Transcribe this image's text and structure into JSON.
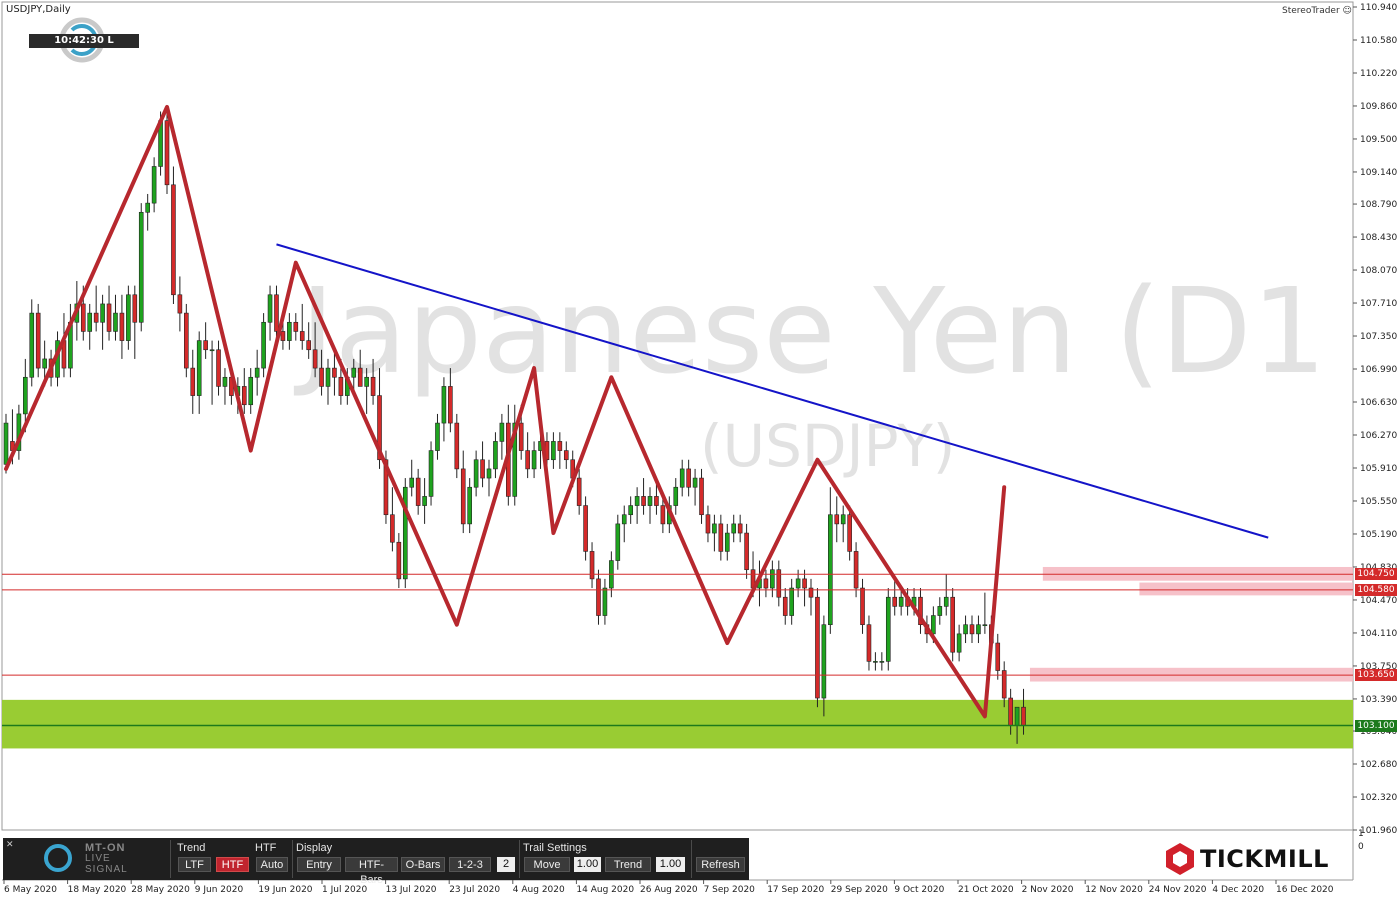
{
  "header": {
    "symbol_label": "USDJPY,Daily",
    "clock": "10:42:30 L",
    "stereo_trader": "StereoTrader"
  },
  "watermark": {
    "title": "Japanese Yen (D1",
    "subtitle": "(USDJPY)"
  },
  "price_axis": {
    "ticks": [
      "110.940",
      "110.580",
      "110.220",
      "109.860",
      "109.500",
      "109.140",
      "108.790",
      "108.430",
      "108.070",
      "107.710",
      "107.350",
      "106.990",
      "106.630",
      "106.270",
      "105.910",
      "105.550",
      "105.190",
      "104.830",
      "104.470",
      "104.110",
      "103.750",
      "103.390",
      "103.040",
      "102.680",
      "102.320",
      "101.960"
    ],
    "ylim": [
      101.96,
      110.94
    ],
    "levels": [
      {
        "value": 104.75,
        "label": "104.750",
        "color": "#d42a2a"
      },
      {
        "value": 104.58,
        "label": "104.580",
        "color": "#d42a2a"
      },
      {
        "value": 103.65,
        "label": "103.650",
        "color": "#d42a2a"
      },
      {
        "value": 103.1,
        "label": "103.100",
        "color": "#1c7a1c"
      }
    ]
  },
  "time_axis": {
    "ticks": [
      "6 May 2020",
      "18 May 2020",
      "28 May 2020",
      "9 Jun 2020",
      "19 Jun 2020",
      "1 Jul 2020",
      "13 Jul 2020",
      "23 Jul 2020",
      "4 Aug 2020",
      "14 Aug 2020",
      "26 Aug 2020",
      "7 Sep 2020",
      "17 Sep 2020",
      "29 Sep 2020",
      "9 Oct 2020",
      "21 Oct 2020",
      "2 Nov 2020",
      "12 Nov 2020",
      "24 Nov 2020",
      "4 Dec 2020",
      "16 Dec 2020"
    ]
  },
  "sub_axis": {
    "ticks": [
      "1",
      "0"
    ]
  },
  "chart_data": {
    "type": "candlestick",
    "series": [
      {
        "candles": [
          [
            105.95,
            106.5,
            105.85,
            106.4
          ],
          [
            106.2,
            106.55,
            105.95,
            106.1
          ],
          [
            106.1,
            106.6,
            106.0,
            106.5
          ],
          [
            106.5,
            107.1,
            106.3,
            106.9
          ],
          [
            106.9,
            107.75,
            106.8,
            107.6
          ],
          [
            107.6,
            107.7,
            106.9,
            107.0
          ],
          [
            107.0,
            107.3,
            106.8,
            107.1
          ],
          [
            107.1,
            107.2,
            106.8,
            106.9
          ],
          [
            106.9,
            107.4,
            106.8,
            107.3
          ],
          [
            107.3,
            107.6,
            106.9,
            107.0
          ],
          [
            107.0,
            107.7,
            106.9,
            107.5
          ],
          [
            107.5,
            107.95,
            107.3,
            107.7
          ],
          [
            107.7,
            107.9,
            107.3,
            107.4
          ],
          [
            107.4,
            107.7,
            107.2,
            107.6
          ],
          [
            107.6,
            107.9,
            107.4,
            107.5
          ],
          [
            107.5,
            107.8,
            107.2,
            107.7
          ],
          [
            107.7,
            107.9,
            107.3,
            107.4
          ],
          [
            107.4,
            107.8,
            107.3,
            107.6
          ],
          [
            107.6,
            107.8,
            107.1,
            107.3
          ],
          [
            107.3,
            107.9,
            107.2,
            107.8
          ],
          [
            107.8,
            107.9,
            107.1,
            107.5
          ],
          [
            107.5,
            108.8,
            107.4,
            108.7
          ],
          [
            108.7,
            108.9,
            108.5,
            108.8
          ],
          [
            108.8,
            109.3,
            108.7,
            109.2
          ],
          [
            109.2,
            109.8,
            109.1,
            109.7
          ],
          [
            109.7,
            109.85,
            108.9,
            109.0
          ],
          [
            109.0,
            109.2,
            107.7,
            107.8
          ],
          [
            107.8,
            108.0,
            107.4,
            107.6
          ],
          [
            107.6,
            107.7,
            106.9,
            107.0
          ],
          [
            107.0,
            107.2,
            106.5,
            106.7
          ],
          [
            106.7,
            107.4,
            106.5,
            107.3
          ],
          [
            107.3,
            107.5,
            107.1,
            107.2
          ],
          [
            107.2,
            107.3,
            106.6,
            107.2
          ],
          [
            107.2,
            107.3,
            106.7,
            106.8
          ],
          [
            106.8,
            107.0,
            106.6,
            106.9
          ],
          [
            106.9,
            107.0,
            106.6,
            106.7
          ],
          [
            106.7,
            106.9,
            106.5,
            106.8
          ],
          [
            106.8,
            107.0,
            106.5,
            106.6
          ],
          [
            106.6,
            107.0,
            106.5,
            106.9
          ],
          [
            106.9,
            107.2,
            106.7,
            107.0
          ],
          [
            107.0,
            107.6,
            106.9,
            107.5
          ],
          [
            107.5,
            107.9,
            107.3,
            107.8
          ],
          [
            107.8,
            107.9,
            107.3,
            107.4
          ],
          [
            107.4,
            107.6,
            107.2,
            107.3
          ],
          [
            107.3,
            107.6,
            107.2,
            107.5
          ],
          [
            107.5,
            107.6,
            107.3,
            107.4
          ],
          [
            107.4,
            107.7,
            107.2,
            107.3
          ],
          [
            107.3,
            107.5,
            107.1,
            107.2
          ],
          [
            107.2,
            107.5,
            106.9,
            107.0
          ],
          [
            107.0,
            107.2,
            106.7,
            106.8
          ],
          [
            106.8,
            107.1,
            106.6,
            107.0
          ],
          [
            107.0,
            107.2,
            106.7,
            106.9
          ],
          [
            106.9,
            107.1,
            106.6,
            106.7
          ],
          [
            106.7,
            107.0,
            106.6,
            106.9
          ],
          [
            106.9,
            107.1,
            106.7,
            107.0
          ],
          [
            107.0,
            107.2,
            106.8,
            106.8
          ],
          [
            106.8,
            107.0,
            106.5,
            106.9
          ],
          [
            106.9,
            107.1,
            106.6,
            106.7
          ],
          [
            106.7,
            107.0,
            105.9,
            106.0
          ],
          [
            106.0,
            106.1,
            105.3,
            105.4
          ],
          [
            105.4,
            105.7,
            105.0,
            105.1
          ],
          [
            105.1,
            105.2,
            104.6,
            104.7
          ],
          [
            104.7,
            105.8,
            104.6,
            105.7
          ],
          [
            105.7,
            106.0,
            105.6,
            105.8
          ],
          [
            105.8,
            105.9,
            105.4,
            105.5
          ],
          [
            105.5,
            105.8,
            105.3,
            105.6
          ],
          [
            105.6,
            106.2,
            105.5,
            106.1
          ],
          [
            106.1,
            106.5,
            106.0,
            106.4
          ],
          [
            106.4,
            106.9,
            106.2,
            106.8
          ],
          [
            106.8,
            107.0,
            106.3,
            106.4
          ],
          [
            106.4,
            106.5,
            105.8,
            105.9
          ],
          [
            105.9,
            106.1,
            105.2,
            105.3
          ],
          [
            105.3,
            105.8,
            105.2,
            105.7
          ],
          [
            105.7,
            106.1,
            105.6,
            106.0
          ],
          [
            106.0,
            106.2,
            105.7,
            105.8
          ],
          [
            105.8,
            106.0,
            105.6,
            105.9
          ],
          [
            105.9,
            106.3,
            105.8,
            106.2
          ],
          [
            106.2,
            106.5,
            106.0,
            106.4
          ],
          [
            106.4,
            106.6,
            105.5,
            105.6
          ],
          [
            105.6,
            106.6,
            105.5,
            106.4
          ],
          [
            106.4,
            106.6,
            106.0,
            106.1
          ],
          [
            106.1,
            106.3,
            105.8,
            105.9
          ],
          [
            105.9,
            106.2,
            105.8,
            106.1
          ],
          [
            106.1,
            106.4,
            105.9,
            106.2
          ],
          [
            106.2,
            106.3,
            105.9,
            106.0
          ],
          [
            106.0,
            106.3,
            105.9,
            106.2
          ],
          [
            106.2,
            106.3,
            105.9,
            106.1
          ],
          [
            106.1,
            106.2,
            105.9,
            106.0
          ],
          [
            106.0,
            106.1,
            105.7,
            105.8
          ],
          [
            105.8,
            105.9,
            105.4,
            105.5
          ],
          [
            105.5,
            105.6,
            104.9,
            105.0
          ],
          [
            105.0,
            105.1,
            104.6,
            104.7
          ],
          [
            104.7,
            104.8,
            104.2,
            104.3
          ],
          [
            104.3,
            104.7,
            104.2,
            104.6
          ],
          [
            104.6,
            105.0,
            104.5,
            104.9
          ],
          [
            104.9,
            105.4,
            104.8,
            105.3
          ],
          [
            105.3,
            105.5,
            105.1,
            105.4
          ],
          [
            105.4,
            105.6,
            105.3,
            105.5
          ],
          [
            105.5,
            105.7,
            105.3,
            105.6
          ],
          [
            105.6,
            105.8,
            105.4,
            105.5
          ],
          [
            105.5,
            105.7,
            105.3,
            105.6
          ],
          [
            105.6,
            105.8,
            105.4,
            105.5
          ],
          [
            105.5,
            105.6,
            105.2,
            105.3
          ],
          [
            105.3,
            105.6,
            105.2,
            105.5
          ],
          [
            105.5,
            105.8,
            105.4,
            105.7
          ],
          [
            105.7,
            106.0,
            105.6,
            105.9
          ],
          [
            105.9,
            106.0,
            105.6,
            105.7
          ],
          [
            105.7,
            105.9,
            105.5,
            105.8
          ],
          [
            105.8,
            105.9,
            105.3,
            105.4
          ],
          [
            105.4,
            105.5,
            105.1,
            105.2
          ],
          [
            105.2,
            105.4,
            105.0,
            105.3
          ],
          [
            105.3,
            105.4,
            104.9,
            105.0
          ],
          [
            105.0,
            105.3,
            104.9,
            105.2
          ],
          [
            105.2,
            105.4,
            105.1,
            105.3
          ],
          [
            105.3,
            105.4,
            105.1,
            105.2
          ],
          [
            105.2,
            105.3,
            104.7,
            104.8
          ],
          [
            104.8,
            105.0,
            104.5,
            104.6
          ],
          [
            104.6,
            104.9,
            104.4,
            104.7
          ],
          [
            104.7,
            104.8,
            104.5,
            104.6
          ],
          [
            104.6,
            104.9,
            104.5,
            104.8
          ],
          [
            104.8,
            104.9,
            104.4,
            104.5
          ],
          [
            104.5,
            104.6,
            104.2,
            104.3
          ],
          [
            104.3,
            104.7,
            104.2,
            104.6
          ],
          [
            104.6,
            104.8,
            104.5,
            104.7
          ],
          [
            104.7,
            104.8,
            104.4,
            104.6
          ],
          [
            104.6,
            104.7,
            104.3,
            104.5
          ],
          [
            104.5,
            104.6,
            103.3,
            103.4
          ],
          [
            103.4,
            104.3,
            103.2,
            104.2
          ],
          [
            104.2,
            105.7,
            104.1,
            105.4
          ],
          [
            105.4,
            105.6,
            105.1,
            105.3
          ],
          [
            105.3,
            105.5,
            105.1,
            105.4
          ],
          [
            105.4,
            105.5,
            104.9,
            105.0
          ],
          [
            105.0,
            105.1,
            104.5,
            104.6
          ],
          [
            104.6,
            104.7,
            104.1,
            104.2
          ],
          [
            104.2,
            104.3,
            103.7,
            103.8
          ],
          [
            103.8,
            103.9,
            103.7,
            103.8
          ],
          [
            103.8,
            103.9,
            103.7,
            103.8
          ],
          [
            103.8,
            104.6,
            103.7,
            104.5
          ],
          [
            104.5,
            104.7,
            104.3,
            104.4
          ],
          [
            104.4,
            104.6,
            104.3,
            104.5
          ],
          [
            104.5,
            104.6,
            104.3,
            104.4
          ],
          [
            104.4,
            104.6,
            104.3,
            104.5
          ],
          [
            104.5,
            104.6,
            104.1,
            104.2
          ],
          [
            104.2,
            104.3,
            104.0,
            104.1
          ],
          [
            104.1,
            104.4,
            104.0,
            104.3
          ],
          [
            104.3,
            104.5,
            104.2,
            104.4
          ],
          [
            104.4,
            104.75,
            104.3,
            104.5
          ],
          [
            104.5,
            104.6,
            103.8,
            103.9
          ],
          [
            103.9,
            104.2,
            103.8,
            104.1
          ],
          [
            104.1,
            104.3,
            104.0,
            104.2
          ],
          [
            104.2,
            104.3,
            104.0,
            104.1
          ],
          [
            104.1,
            104.3,
            104.0,
            104.2
          ],
          [
            104.2,
            104.55,
            104.1,
            104.2
          ],
          [
            104.2,
            104.3,
            103.9,
            104.0
          ],
          [
            104.0,
            104.1,
            103.6,
            103.7
          ],
          [
            103.7,
            103.8,
            103.3,
            103.4
          ],
          [
            103.4,
            103.5,
            103.0,
            103.1
          ],
          [
            103.1,
            103.3,
            102.9,
            103.3
          ],
          [
            103.3,
            103.5,
            103.0,
            103.1
          ]
        ]
      }
    ]
  },
  "zigzag": [
    [
      0,
      105.9
    ],
    [
      25,
      109.85
    ],
    [
      38,
      106.1
    ],
    [
      45,
      108.15
    ],
    [
      70,
      104.2
    ],
    [
      82,
      107.0
    ],
    [
      85,
      105.2
    ],
    [
      94,
      106.9
    ],
    [
      112,
      104.0
    ],
    [
      126,
      106.0
    ],
    [
      152,
      103.2
    ],
    [
      155,
      105.7
    ]
  ],
  "trendline": [
    [
      42,
      108.35
    ],
    [
      196,
      105.15
    ]
  ],
  "resistance_zones": [
    {
      "from": 161,
      "to": 195,
      "low": 104.68,
      "high": 104.83
    },
    {
      "from": 176,
      "to": 195,
      "low": 104.52,
      "high": 104.66
    },
    {
      "from": 159,
      "to": 195,
      "low": 103.58,
      "high": 103.73
    }
  ],
  "support_zone": {
    "low": 102.85,
    "high": 103.38
  },
  "panel": {
    "logo_line1": "MT-ON",
    "logo_line2": "LIVE",
    "logo_line3": "SIGNAL",
    "trend": {
      "title": "Trend",
      "ltf": "LTF",
      "htf": "HTF"
    },
    "htf": {
      "title": "HTF",
      "auto": "Auto"
    },
    "display": {
      "title": "Display",
      "entry": "Entry",
      "htf_bars": "HTF-Bars",
      "o_bars": "O-Bars",
      "one_two_three": "1-2-3",
      "count": "2"
    },
    "trail": {
      "title": "Trail Settings",
      "move": "Move",
      "move_val": "1.00",
      "trend": "Trend",
      "trend_val": "1.00",
      "refresh": "Refresh"
    }
  },
  "brand": {
    "name": "TICKMILL"
  },
  "colors": {
    "bull": "#1fa31f",
    "bear": "#d42a2a",
    "zigzag": "#b7282e",
    "trendline": "#1414c8",
    "support": "#99cc33",
    "resistance_zone": "#f4b6bf",
    "panel_accent": "#c0242e"
  }
}
